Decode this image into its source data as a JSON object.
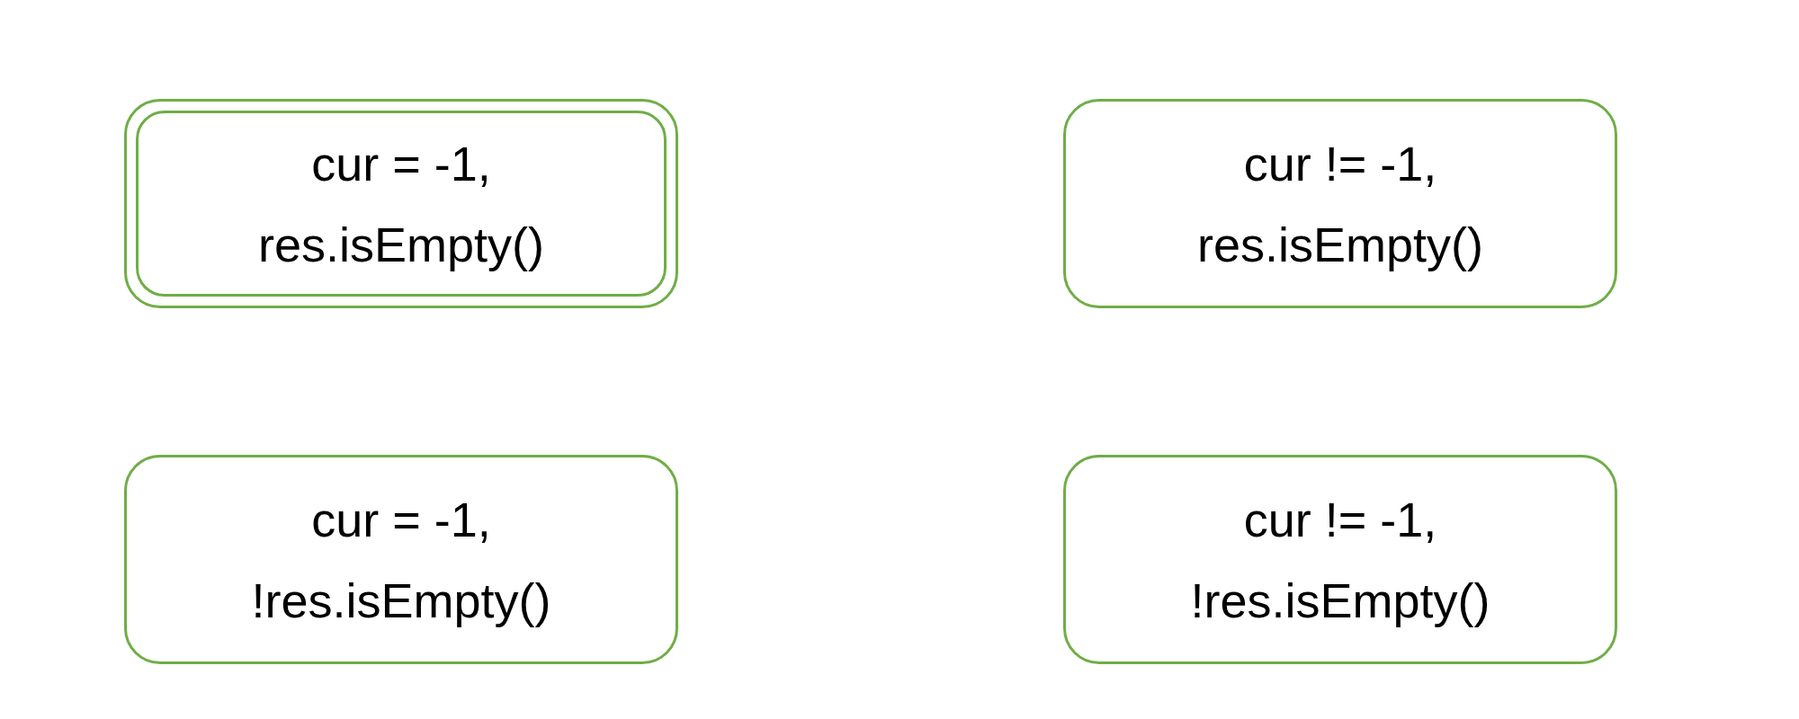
{
  "states": [
    {
      "lines": [
        "cur = -1,",
        "res.isEmpty()"
      ],
      "accepting": true
    },
    {
      "lines": [
        "cur != -1,",
        "res.isEmpty()"
      ],
      "accepting": false
    },
    {
      "lines": [
        "cur = -1,",
        "!res.isEmpty()"
      ],
      "accepting": false
    },
    {
      "lines": [
        "cur != -1,",
        "!res.isEmpty()"
      ],
      "accepting": false
    }
  ]
}
